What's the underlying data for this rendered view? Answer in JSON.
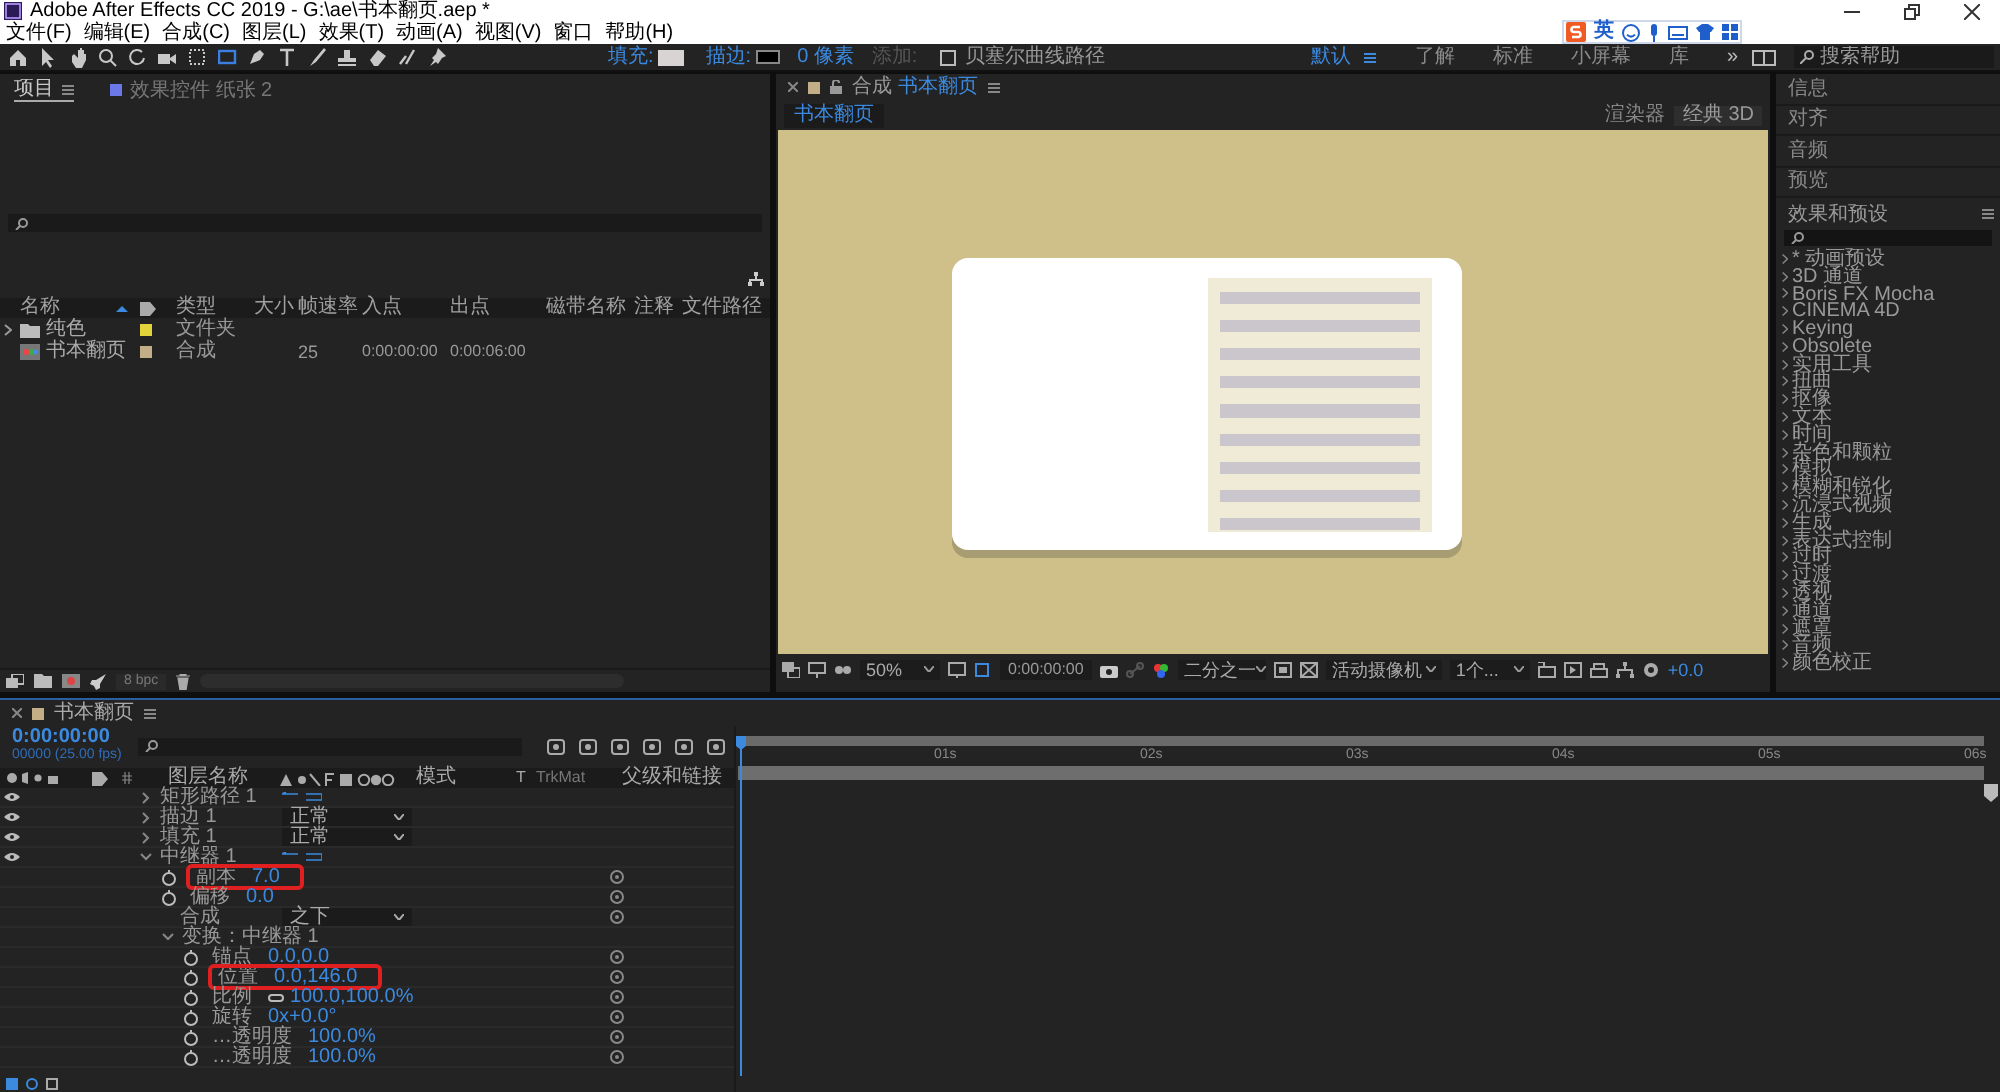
{
  "title_bar": {
    "title": "Adobe After Effects CC 2019 - G:\\ae\\书本翻页.aep *"
  },
  "menu": [
    "文件(F)",
    "编辑(E)",
    "合成(C)",
    "图层(L)",
    "效果(T)",
    "动画(A)",
    "视图(V)",
    "窗口",
    "帮助(H)"
  ],
  "ime_bar": {
    "mode": "英"
  },
  "toolbar": {
    "fill_label": "填充:",
    "stroke_label": "描边:",
    "stroke_width": "0 像素",
    "add_label": "添加:",
    "bezier": {
      "label": "贝塞尔曲线路径",
      "checked": false
    }
  },
  "workspaces": [
    {
      "label": "默认",
      "selected": true
    },
    {
      "label": "了解",
      "selected": false
    },
    {
      "label": "标准",
      "selected": false
    },
    {
      "label": "小屏幕",
      "selected": false
    },
    {
      "label": "库",
      "selected": false
    }
  ],
  "workspace_more": "»",
  "help_search": {
    "placeholder": "搜索帮助"
  },
  "project": {
    "tabs": [
      {
        "label": "项目",
        "selected": true
      },
      {
        "label": "效果控件 纸张 2",
        "selected": false
      }
    ],
    "columns": [
      "名称",
      "类型",
      "大小",
      "帧速率",
      "入点",
      "出点",
      "磁带名称",
      "注释",
      "文件路径"
    ],
    "rows": [
      {
        "kind": "folder",
        "name": "纯色",
        "color": "#e3d33a",
        "type": "文件夹"
      },
      {
        "kind": "comp",
        "name": "书本翻页",
        "color": "#c4ae86",
        "type": "合成",
        "frame_rate": "25",
        "in": "0:00:00:00",
        "out": "0:00:06:00"
      }
    ],
    "bpc": "8 bpc"
  },
  "composition": {
    "panel_label": "合成",
    "name": "书本翻页",
    "subtab": "书本翻页",
    "renderer_label": "渲染器",
    "renderer": "经典 3D",
    "viewer_bar": {
      "zoom": "50%",
      "time": "0:00:00:00",
      "resolution": "二分之一",
      "camera": "活动摄像机",
      "views": "1个...",
      "exposure": "+0.0"
    }
  },
  "side_panels": [
    "信息",
    "对齐",
    "音频",
    "预览"
  ],
  "effects": {
    "title": "效果和预设",
    "items": [
      "* 动画预设",
      "3D 通道",
      "Boris FX Mocha",
      "CINEMA 4D",
      "Keying",
      "Obsolete",
      "实用工具",
      "扭曲",
      "抠像",
      "文本",
      "时间",
      "杂色和颗粒",
      "模拟",
      "模糊和锐化",
      "沉浸式视频",
      "生成",
      "表达式控制",
      "过时",
      "过渡",
      "透视",
      "通道",
      "遮罩",
      "音频",
      "颜色校正"
    ]
  },
  "timeline": {
    "comp": "书本翻页",
    "time": "0:00:00:00",
    "frames": "00000 (25.00 fps)",
    "columns": {
      "layer_name": "图层名称",
      "mode": "模式",
      "t": "T",
      "trkmat": "TrkMat",
      "parent": "父级和链接"
    },
    "rows": [
      {
        "kind": "group",
        "name": "矩形路径 1",
        "expanded": false
      },
      {
        "kind": "group",
        "name": "描边 1",
        "expanded": false,
        "value": "正常"
      },
      {
        "kind": "group",
        "name": "填充 1",
        "expanded": false,
        "value": "正常"
      },
      {
        "kind": "group",
        "name": "中继器 1",
        "expanded": true,
        "children": [
          {
            "kind": "property",
            "name": "副本",
            "value": "7.0",
            "highlighted": true
          },
          {
            "kind": "property",
            "name": "偏移",
            "value": "0.0"
          },
          {
            "kind": "dropdown",
            "name": "合成",
            "value": "之下"
          },
          {
            "kind": "group",
            "name": "变换：中继器 1",
            "expanded": true,
            "children": [
              {
                "kind": "property",
                "name": "锚点",
                "value": "0.0,0.0"
              },
              {
                "kind": "property",
                "name": "位置",
                "value": "0.0,146.0",
                "highlighted": true
              },
              {
                "kind": "property",
                "name": "比例",
                "value": "100.0,100.0%",
                "linked": true
              },
              {
                "kind": "property",
                "name": "旋转",
                "value": "0x+0.0°"
              },
              {
                "kind": "property",
                "name": "…透明度",
                "value": "100.0%"
              },
              {
                "kind": "property",
                "name": "…透明度",
                "value": "100.0%"
              }
            ]
          }
        ]
      }
    ],
    "ruler": [
      "01s",
      "02s",
      "03s",
      "04s",
      "05s",
      "06s"
    ]
  }
}
